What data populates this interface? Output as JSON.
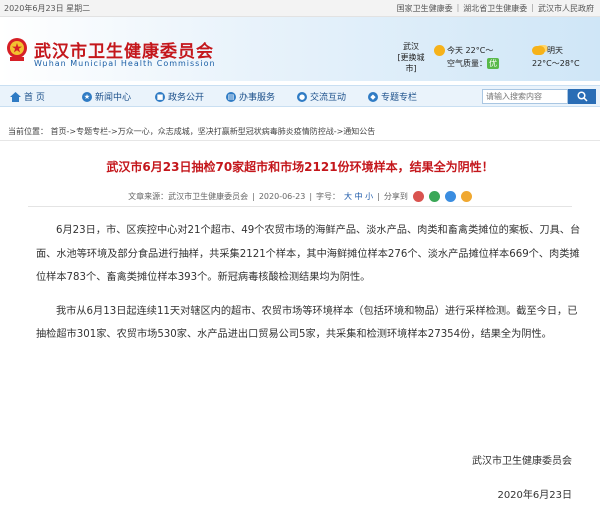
{
  "topbar": {
    "date": "2020年6月23日 星期二",
    "links": [
      "国家卫生健康委",
      "湖北省卫生健康委",
      "武汉市人民政府"
    ]
  },
  "header": {
    "title_cn": "武汉市卫生健康委员会",
    "title_en": "Wuhan Municipal Health Commission"
  },
  "weather": {
    "city": "武汉",
    "switch_city": "[更换城市]",
    "today_label": "今天",
    "today_temp": "22°C～",
    "aqi_label": "空气质量：",
    "aqi_value": "优",
    "tomorrow_label": "明天",
    "tomorrow_temp": "22°C～28°C"
  },
  "nav": {
    "items": [
      "首 页",
      "新闻中心",
      "政务公开",
      "办事服务",
      "交流互动",
      "专题专栏"
    ],
    "search_placeholder": "请输入搜索内容"
  },
  "breadcrumb": {
    "text": "当前位置： 首页->专题专栏->万众一心，众志成城，坚决打赢新型冠状病毒肺炎疫情防控战->通知公告"
  },
  "article": {
    "title": "武汉市6月23日抽检70家超市和市场2121份环境样本，结果全为阴性！",
    "source": "文章来源：武汉市卫生健康委员会",
    "date": "2020-06-23",
    "font_label": "字号：",
    "font_options": "大 中 小",
    "share_label": "分享到",
    "paragraphs": [
      "6月23日，市、区疾控中心对21个超市、49个农贸市场的海鲜产品、淡水产品、肉类和畜禽类摊位的案板、刀具、台面、水池等环境及部分食品进行抽样，共采集2121个样本，其中海鲜摊位样本276个、淡水产品摊位样本669个、肉类摊位样本783个、畜禽类摊位样本393个。新冠病毒核酸检测结果均为阴性。",
      "我市从6月13日起连续11天对辖区内的超市、农贸市场等环境样本（包括环境和物品）进行采样检测。截至今日，已抽检超市301家、农贸市场530家、水产品进出口贸易公司5家，共采集和检测环境样本27354份，结果全为阴性。"
    ],
    "signature": "武汉市卫生健康委员会",
    "sign_date": "2020年6月23日"
  },
  "colors": {
    "title_red": "#c4171c",
    "nav_blue": "#1b4f8a",
    "search_btn": "#2a6db5"
  }
}
